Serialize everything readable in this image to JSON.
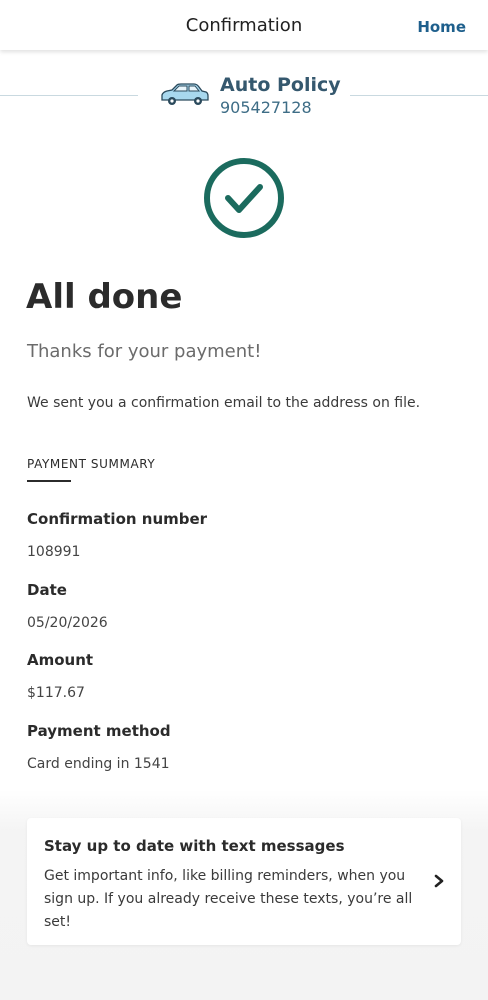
{
  "header": {
    "title": "Confirmation",
    "home_label": "Home"
  },
  "policy": {
    "name": "Auto Policy",
    "number": "905427128",
    "icon": "car-icon"
  },
  "status": {
    "icon": "check-circle-icon",
    "color": "#1b6b5e"
  },
  "title": "All done",
  "subtitle": "Thanks for your payment!",
  "message": "We sent you a confirmation email to the address on file.",
  "summary": {
    "heading": "PAYMENT SUMMARY",
    "confirmation_label": "Confirmation number",
    "confirmation_value": "108991",
    "date_label": "Date",
    "date_value": "05/20/2026",
    "amount_label": "Amount",
    "amount_value": "$117.67",
    "method_label": "Payment method",
    "method_value": "Card ending in 1541"
  },
  "sms_card": {
    "title": "Stay up to date with text messages",
    "body": "Get important info, like billing reminders, when you sign up. If you already receive these texts, you’re all set!",
    "icon": "chevron-right-icon"
  }
}
